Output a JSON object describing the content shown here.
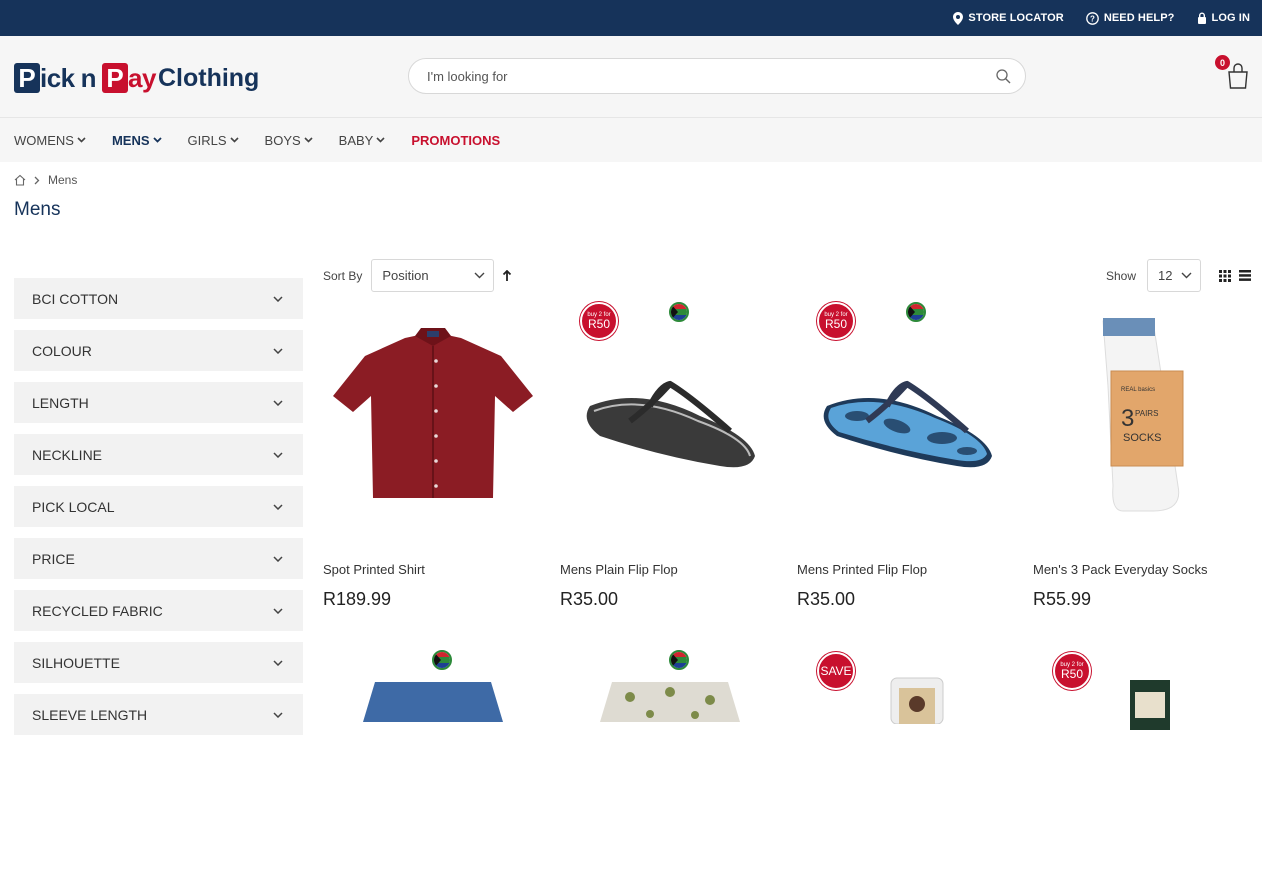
{
  "topbar": {
    "store_locator": "STORE LOCATOR",
    "need_help": "NEED HELP?",
    "log_in": "LOG IN"
  },
  "logo": {
    "p1": "P",
    "t1": "ick",
    "n": "n",
    "p2": "P",
    "t2": "ay",
    "t3": "Clothing"
  },
  "search": {
    "placeholder": "I'm looking for"
  },
  "cart": {
    "count": "0"
  },
  "nav": {
    "items": [
      {
        "label": "WOMENS"
      },
      {
        "label": "MENS"
      },
      {
        "label": "GIRLS"
      },
      {
        "label": "BOYS"
      },
      {
        "label": "BABY"
      },
      {
        "label": "PROMOTIONS"
      }
    ]
  },
  "breadcrumb": {
    "current": "Mens"
  },
  "page_title": "Mens",
  "filters": [
    {
      "label": "BCI COTTON"
    },
    {
      "label": "COLOUR"
    },
    {
      "label": "LENGTH"
    },
    {
      "label": "NECKLINE"
    },
    {
      "label": "PICK LOCAL"
    },
    {
      "label": "PRICE"
    },
    {
      "label": "RECYCLED FABRIC"
    },
    {
      "label": "SILHOUETTE"
    },
    {
      "label": "SLEEVE LENGTH"
    }
  ],
  "toolbar": {
    "sort_label": "Sort By",
    "sort_value": "Position",
    "show_label": "Show",
    "show_value": "12"
  },
  "colors": {
    "navy": "#16335a",
    "red": "#c8102e"
  },
  "products": [
    {
      "name": "Spot Printed Shirt",
      "price": "R189.99",
      "badge": "",
      "local": false
    },
    {
      "name": "Mens Plain Flip Flop",
      "price": "R35.00",
      "badge_small": "buy 2 for",
      "badge": "R50",
      "local": true
    },
    {
      "name": "Mens Printed Flip Flop",
      "price": "R35.00",
      "badge_small": "buy 2 for",
      "badge": "R50",
      "local": true
    },
    {
      "name": "Men's 3 Pack Everyday Socks",
      "price": "R55.99",
      "badge": "",
      "local": false
    },
    {
      "name": "",
      "price": "",
      "badge": "",
      "local": true
    },
    {
      "name": "",
      "price": "",
      "badge": "",
      "local": true
    },
    {
      "name": "",
      "price": "",
      "badge": "SAVE",
      "local": false
    },
    {
      "name": "",
      "price": "",
      "badge_small": "buy 2 for",
      "badge": "R50",
      "local": false
    }
  ]
}
